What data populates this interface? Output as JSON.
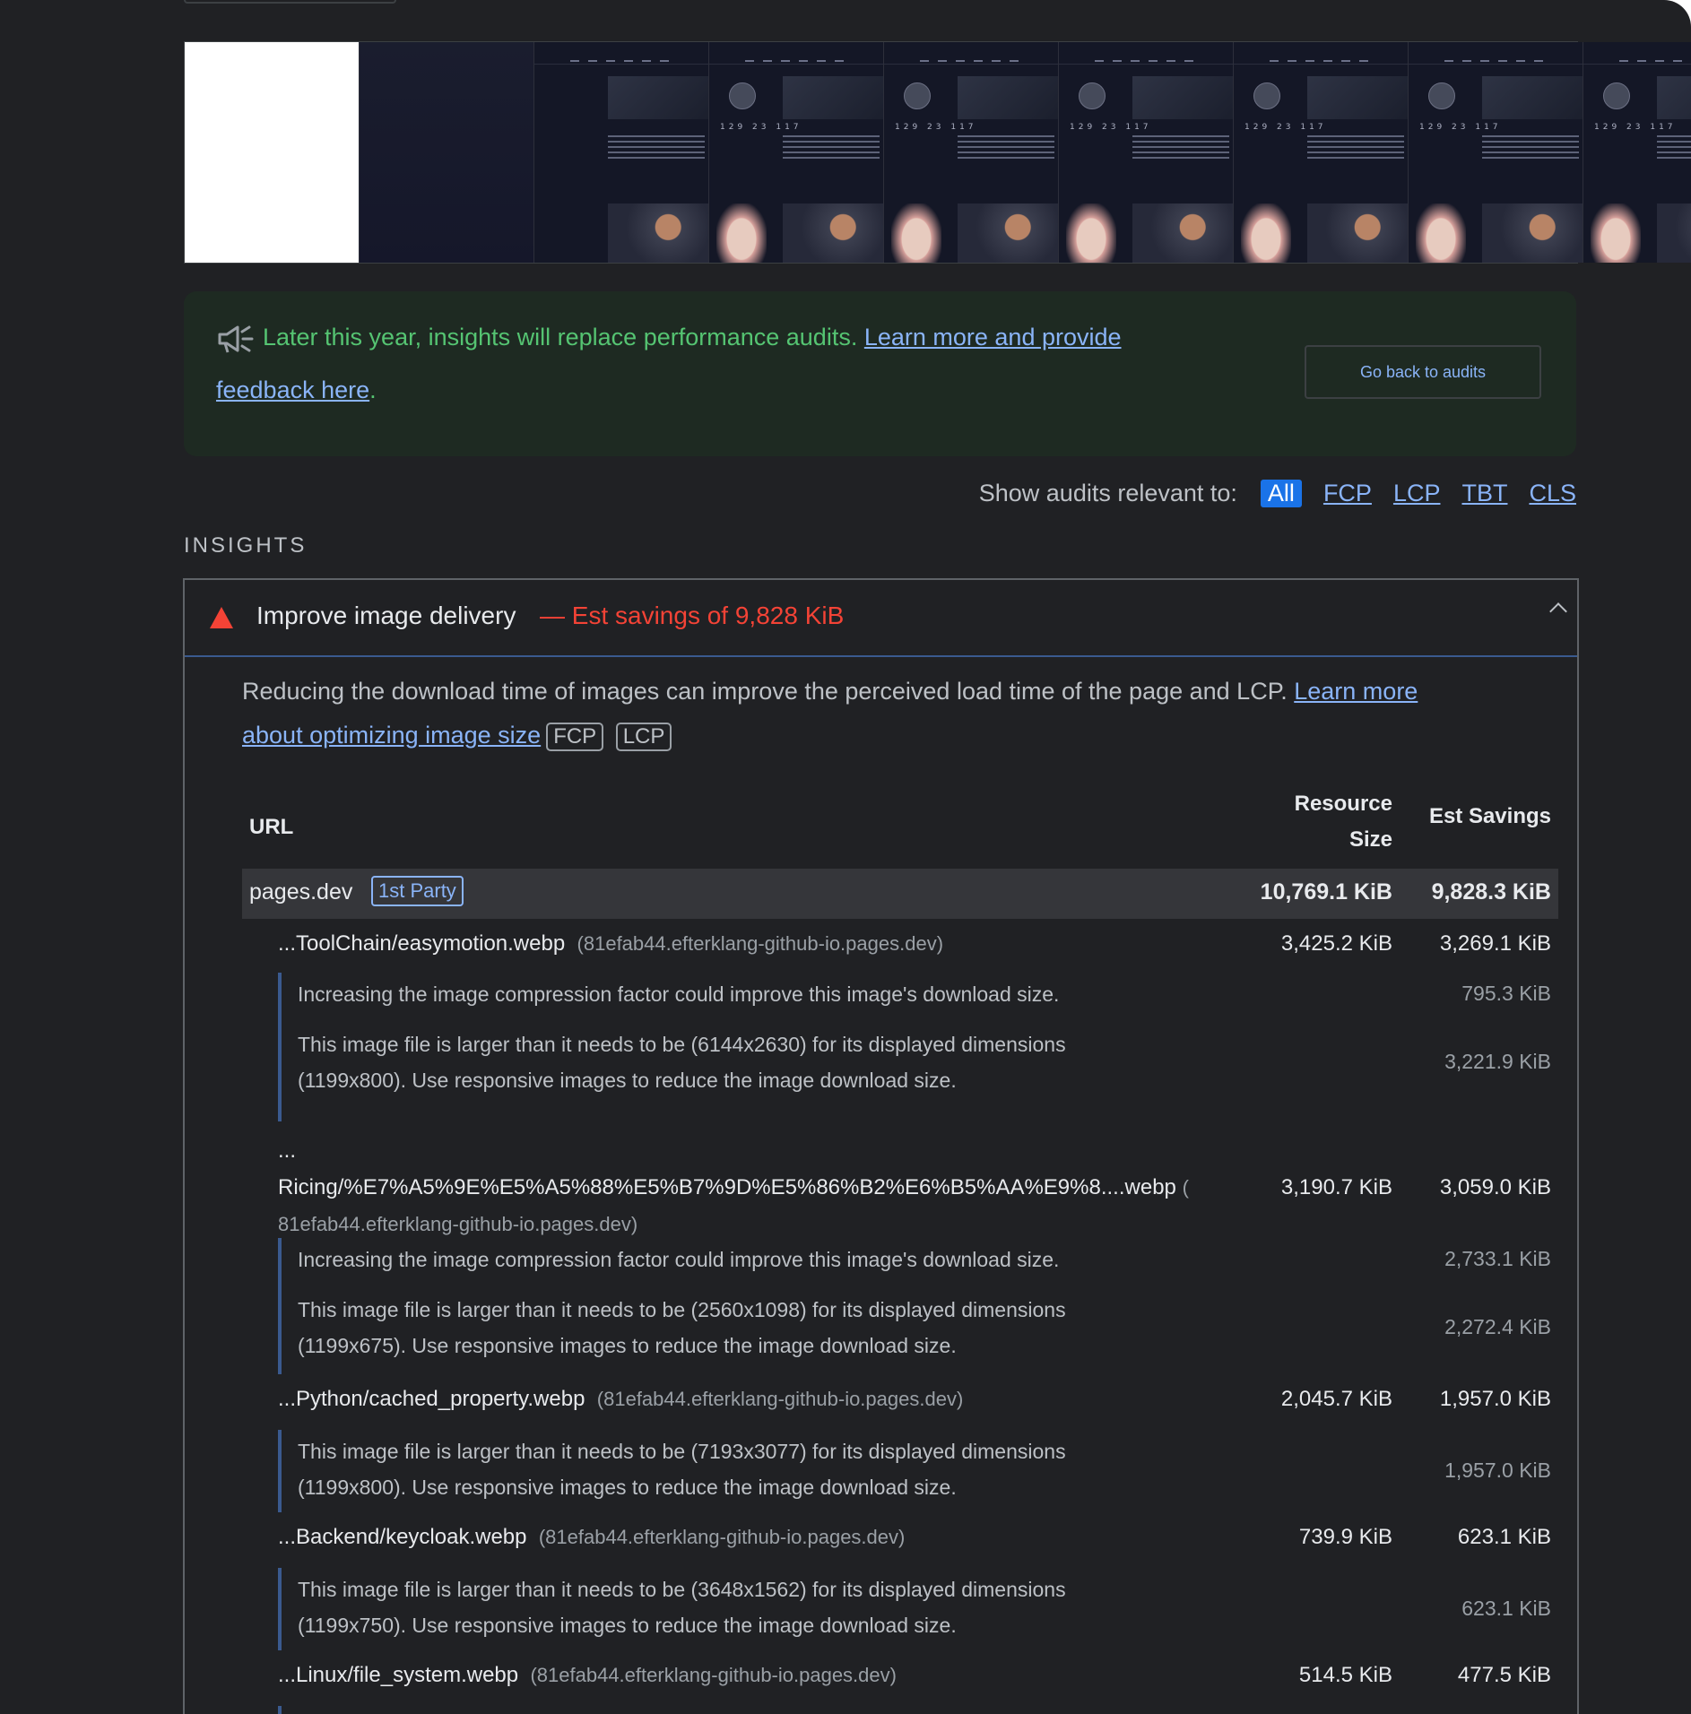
{
  "notice": {
    "text": "Later this year, insights will replace performance audits.",
    "link_line1": "Learn more and provide",
    "link_line2": "feedback here",
    "tail": ".",
    "back_button": "Go back to audits"
  },
  "filter": {
    "label": "Show audits relevant to:",
    "chips": [
      "All",
      "FCP",
      "LCP",
      "TBT",
      "CLS"
    ],
    "active": "All"
  },
  "section_heading": "INSIGHTS",
  "insight": {
    "title": "Improve image delivery",
    "savings": "— Est savings of 9,828 KiB",
    "description": "Reducing the download time of images can improve the perceived load time of the page and LCP.",
    "learn_more_1": "Learn more",
    "learn_more_2": "about optimizing image size",
    "badges": [
      "FCP",
      "LCP"
    ],
    "table": {
      "col_url": "URL",
      "col_size_1": "Resource",
      "col_size_2": "Size",
      "col_savings": "Est Savings",
      "group": {
        "name": "pages.dev",
        "badge": "1st Party",
        "size": "10,769.1 KiB",
        "savings": "9,828.3 KiB"
      },
      "items": [
        {
          "url": "...ToolChain/easymotion.webp",
          "host": "(81efab44.efterklang-github-io.pages.dev)",
          "size": "3,425.2 KiB",
          "savings": "3,269.1 KiB",
          "subs": [
            {
              "text": "Increasing the image compression factor could improve this image's download size.",
              "savings": "795.3 KiB"
            },
            {
              "text": "This image file is larger than it needs to be (6144x2630) for its displayed dimensions (1199x800). Use responsive images to reduce the image download size.",
              "savings": "3,221.9 KiB"
            }
          ]
        },
        {
          "url_prefix": "...",
          "url": "Ricing/%E7%A5%9E%E5%A5%88%E5%B7%9D%E5%86%B2%E6%B5%AA%E9%8....webp",
          "host_open": "(",
          "host": "81efab44.efterklang-github-io.pages.dev)",
          "size": "3,190.7 KiB",
          "savings": "3,059.0 KiB",
          "subs": [
            {
              "text": "Increasing the image compression factor could improve this image's download size.",
              "savings": "2,733.1 KiB"
            },
            {
              "text": "This image file is larger than it needs to be (2560x1098) for its displayed dimensions (1199x675). Use responsive images to reduce the image download size.",
              "savings": "2,272.4 KiB"
            }
          ]
        },
        {
          "url": "...Python/cached_property.webp",
          "host": "(81efab44.efterklang-github-io.pages.dev)",
          "size": "2,045.7 KiB",
          "savings": "1,957.0 KiB",
          "subs": [
            {
              "text": "This image file is larger than it needs to be (7193x3077) for its displayed dimensions (1199x800). Use responsive images to reduce the image download size.",
              "savings": "1,957.0 KiB"
            }
          ]
        },
        {
          "url": "...Backend/keycloak.webp",
          "host": "(81efab44.efterklang-github-io.pages.dev)",
          "size": "739.9 KiB",
          "savings": "623.1 KiB",
          "subs": [
            {
              "text": "This image file is larger than it needs to be (3648x1562) for its displayed dimensions (1199x750). Use responsive images to reduce the image download size.",
              "savings": "623.1 KiB"
            }
          ]
        },
        {
          "url": "...Linux/file_system.webp",
          "host": "(81efab44.efterklang-github-io.pages.dev)",
          "size": "514.5 KiB",
          "savings": "477.5 KiB",
          "subs": []
        }
      ]
    }
  },
  "filmstrip": {
    "frame_stats": "129 23 117"
  }
}
